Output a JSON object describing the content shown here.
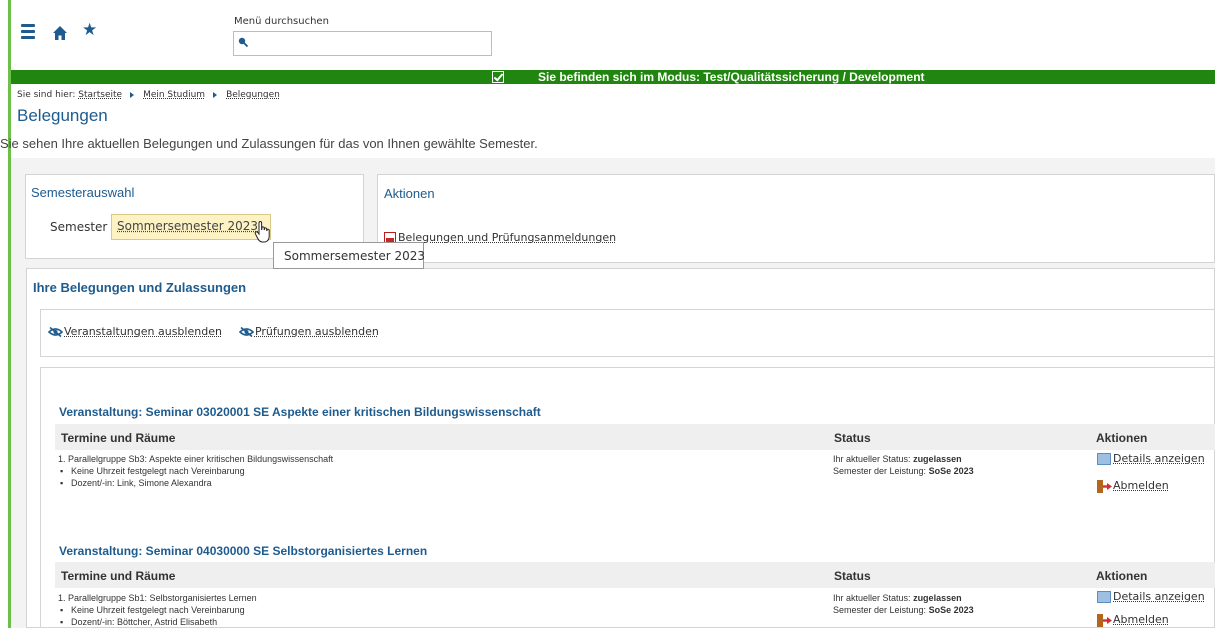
{
  "header": {
    "search_label": "Menü durchsuchen",
    "search_placeholder": "",
    "icons": [
      "menu-icon",
      "home-icon",
      "star-icon",
      "search-icon"
    ]
  },
  "mode_bar": {
    "text": "Sie befinden sich im Modus: Test/Qualitätssicherung / Development",
    "color": "#21860f"
  },
  "breadcrumb": {
    "prefix": "Sie sind hier:",
    "items": [
      "Startseite",
      "Mein Studium",
      "Belegungen"
    ]
  },
  "page": {
    "title": "Belegungen",
    "subtitle": "Sie sehen Ihre aktuellen Belegungen und Zulassungen für das von Ihnen gewählte Semester."
  },
  "semesterauswahl": {
    "title": "Semesterauswahl",
    "label": "Semester",
    "selected": "Sommersemester 2023",
    "tooltip": "Sommersemester 2023"
  },
  "aktionen": {
    "title": "Aktionen",
    "pdf_link": "Belegungen und Prüfungsanmeldungen"
  },
  "belegungen": {
    "title": "Ihre Belegungen und Zulassungen",
    "toggle_veranstaltungen": "Veranstaltungen ausblenden",
    "toggle_pruefungen": "Prüfungen ausblenden",
    "columns": [
      "Termine und Räume",
      "Status",
      "Aktionen"
    ],
    "courses": [
      {
        "title": "Veranstaltung: Seminar 03020001 SE Aspekte einer kritischen Bildungswissenschaft",
        "group": "1. Parallelgruppe Sb3: Aspekte einer kritischen Bildungswissenschaft",
        "bullets": [
          "Keine Uhrzeit festgelegt nach Vereinbarung",
          "Dozent/-in: Link, Simone Alexandra"
        ],
        "status_label": "Ihr aktueller Status:",
        "status_value": "zugelassen",
        "semester_label": "Semester der Leistung:",
        "semester_value": "SoSe 2023",
        "details": "Details anzeigen",
        "abmelden": "Abmelden"
      },
      {
        "title": "Veranstaltung: Seminar 04030000 SE Selbstorganisiertes Lernen",
        "group": "1. Parallelgruppe Sb1: Selbstorganisiertes Lernen",
        "bullets": [
          "Keine Uhrzeit festgelegt nach Vereinbarung",
          "Dozent/-in: Böttcher, Astrid Elisabeth"
        ],
        "status_label": "Ihr aktueller Status:",
        "status_value": "zugelassen",
        "semester_label": "Semester der Leistung:",
        "semester_value": "SoSe 2023",
        "details": "Details anzeigen",
        "abmelden": "Abmelden"
      }
    ]
  }
}
